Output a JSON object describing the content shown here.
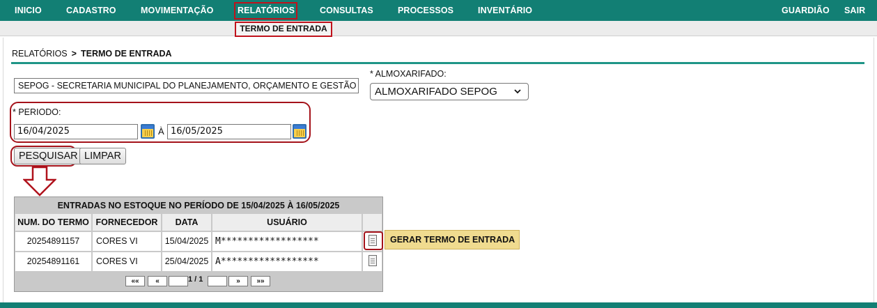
{
  "nav": {
    "items": [
      "INICIO",
      "CADASTRO",
      "MOVIMENTAÇÃO",
      "RELATÓRIOS",
      "CONSULTAS",
      "PROCESSOS",
      "INVENTÁRIO"
    ],
    "right": [
      "GUARDIÃO",
      "SAIR"
    ],
    "submenu": "TERMO DE ENTRADA"
  },
  "breadcrumb": {
    "parent": "RELATÓRIOS",
    "separator": ">",
    "current": "TERMO DE ENTRADA"
  },
  "form": {
    "secretaria": "SEPOG - SECRETARIA MUNICIPAL DO PLANEJAMENTO, ORÇAMENTO E GESTÃO",
    "almoxarifado_label": "* ALMOXARIFADO:",
    "almoxarifado_value": "ALMOXARIFADO SEPOG",
    "periodo_label": "* PERIODO:",
    "date_from": "16/04/2025",
    "date_sep": "À",
    "date_to": "16/05/2025",
    "pesquisar": "PESQUISAR",
    "limpar": "LIMPAR"
  },
  "table": {
    "title": "ENTRADAS NO ESTOQUE NO PERÍODO DE 15/04/2025 À 16/05/2025",
    "headers": [
      "NUM. DO TERMO",
      "FORNECEDOR",
      "DATA",
      "USUÁRIO"
    ],
    "rows": [
      [
        "20254891157",
        "CORES VI",
        "15/04/2025",
        "M******************"
      ],
      [
        "20254891161",
        "CORES VI",
        "25/04/2025",
        "A******************"
      ]
    ],
    "gerar_label": "GERAR TERMO DE ENTRADA",
    "pager": {
      "first": "««",
      "prev": "«",
      "page": "1 / 1",
      "next": "»",
      "last": "»»"
    }
  },
  "colors": {
    "nav": "#127f74",
    "highlight": "#a4121a",
    "gerar_bg": "#f0db8f"
  }
}
